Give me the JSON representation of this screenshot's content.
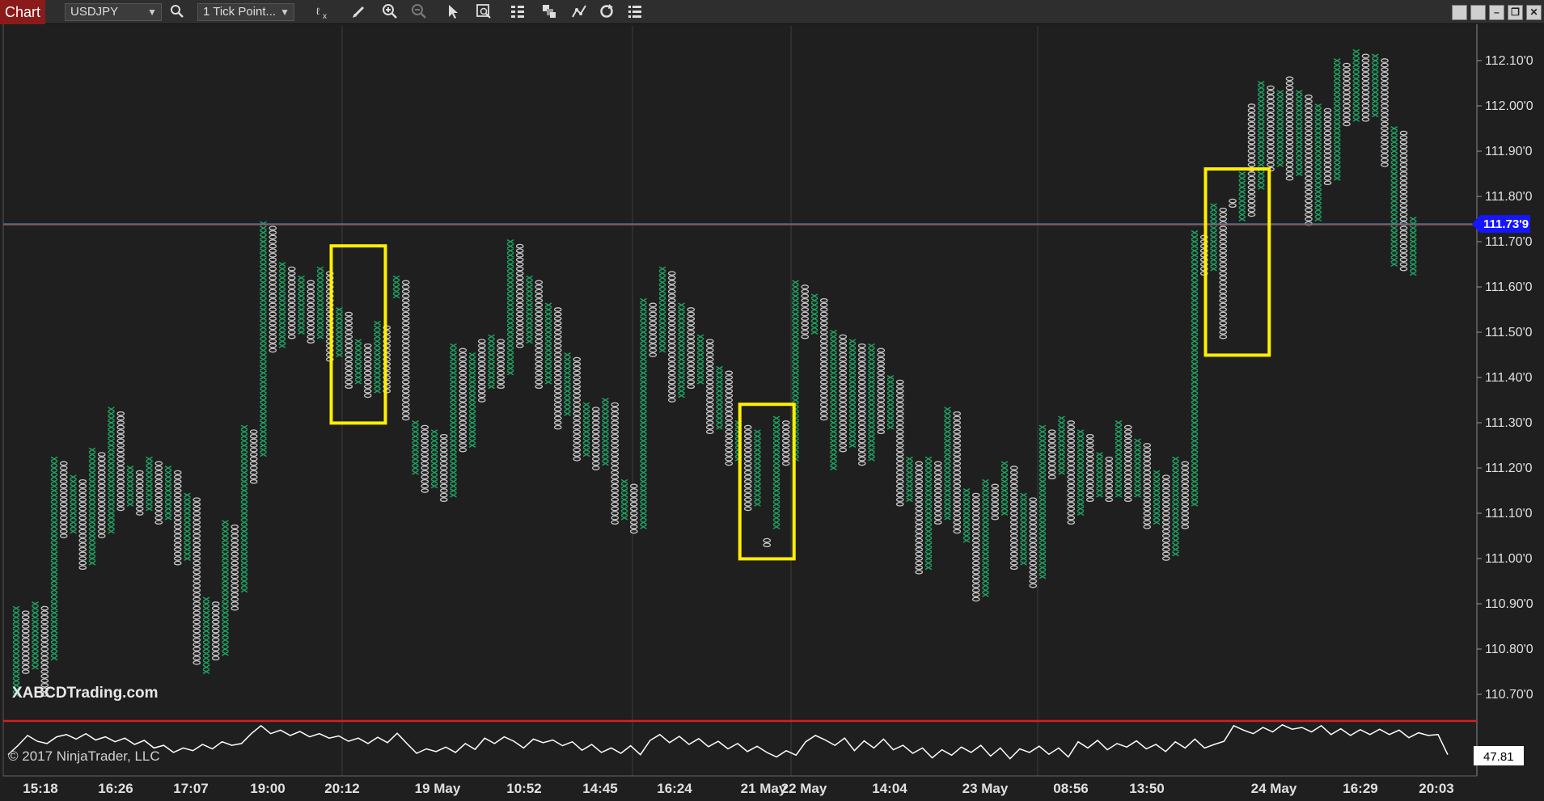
{
  "window": {
    "tab_label": "Chart"
  },
  "toolbar": {
    "instrument": "USDJPY",
    "bar_type": "1 Tick Point...",
    "icons": [
      "search-icon",
      "indicator-icon",
      "draw-pencil-icon",
      "zoom-in-icon",
      "zoom-out-icon",
      "pointer-icon",
      "data-box-icon",
      "grid-icon",
      "strategies-icon",
      "drawing-tools-icon",
      "reload-icon",
      "properties-icon"
    ],
    "window_buttons": [
      "tile-left",
      "tile-right",
      "minimize",
      "maximize",
      "close"
    ]
  },
  "watermark": "XABCDTrading.com",
  "copyright": "© 2017 NinjaTrader, LLC",
  "price_axis": {
    "labels": [
      "112.10'0",
      "112.00'0",
      "111.90'0",
      "111.80'0",
      "111.70'0",
      "111.60'0",
      "111.50'0",
      "111.40'0",
      "111.30'0",
      "111.20'0",
      "111.10'0",
      "111.00'0",
      "110.90'0",
      "110.80'0",
      "110.70'0"
    ],
    "current_price": "111.73'9",
    "current_price_color": "#1515ff"
  },
  "indicator": {
    "current_value": "47.81"
  },
  "time_axis": {
    "labels": [
      "15:18",
      "16:26",
      "17:07",
      "19:00",
      "20:12",
      "19 May",
      "10:52",
      "14:45",
      "16:24",
      "21 May",
      "22 May",
      "14:04",
      "23 May",
      "08:56",
      "13:50",
      "24 May",
      "16:29",
      "20:03"
    ]
  },
  "colors": {
    "up": "#1fa463",
    "down": "#c8c8c8",
    "highlight": "#ffef00",
    "background": "#1f1f1f"
  },
  "chart_data": {
    "type": "point_and_figure",
    "instrument": "USDJPY",
    "box_size": 0.01,
    "current_price": 111.739,
    "ylim": [
      110.65,
      112.15
    ],
    "columns": [
      {
        "dir": "up",
        "low": 110.7,
        "high": 110.89
      },
      {
        "dir": "down",
        "low": 110.75,
        "high": 110.88
      },
      {
        "dir": "up",
        "low": 110.76,
        "high": 110.9
      },
      {
        "dir": "down",
        "low": 110.7,
        "high": 110.89
      },
      {
        "dir": "up",
        "low": 110.78,
        "high": 111.22
      },
      {
        "dir": "down",
        "low": 111.05,
        "high": 111.21
      },
      {
        "dir": "up",
        "low": 111.06,
        "high": 111.18
      },
      {
        "dir": "down",
        "low": 110.98,
        "high": 111.17
      },
      {
        "dir": "up",
        "low": 110.99,
        "high": 111.24
      },
      {
        "dir": "down",
        "low": 111.05,
        "high": 111.23
      },
      {
        "dir": "up",
        "low": 111.06,
        "high": 111.33
      },
      {
        "dir": "down",
        "low": 111.11,
        "high": 111.32
      },
      {
        "dir": "up",
        "low": 111.12,
        "high": 111.2
      },
      {
        "dir": "down",
        "low": 111.1,
        "high": 111.19
      },
      {
        "dir": "up",
        "low": 111.11,
        "high": 111.22
      },
      {
        "dir": "down",
        "low": 111.08,
        "high": 111.21
      },
      {
        "dir": "up",
        "low": 111.09,
        "high": 111.2
      },
      {
        "dir": "down",
        "low": 110.99,
        "high": 111.19
      },
      {
        "dir": "up",
        "low": 111.0,
        "high": 111.14
      },
      {
        "dir": "down",
        "low": 110.77,
        "high": 111.13
      },
      {
        "dir": "up",
        "low": 110.75,
        "high": 110.91
      },
      {
        "dir": "down",
        "low": 110.78,
        "high": 110.9
      },
      {
        "dir": "up",
        "low": 110.79,
        "high": 111.08
      },
      {
        "dir": "down",
        "low": 110.89,
        "high": 111.07
      },
      {
        "dir": "up",
        "low": 110.93,
        "high": 111.29
      },
      {
        "dir": "down",
        "low": 111.17,
        "high": 111.28
      },
      {
        "dir": "up",
        "low": 111.23,
        "high": 111.74
      },
      {
        "dir": "down",
        "low": 111.46,
        "high": 111.73
      },
      {
        "dir": "up",
        "low": 111.47,
        "high": 111.65
      },
      {
        "dir": "down",
        "low": 111.49,
        "high": 111.64
      },
      {
        "dir": "up",
        "low": 111.5,
        "high": 111.62
      },
      {
        "dir": "down",
        "low": 111.48,
        "high": 111.61
      },
      {
        "dir": "up",
        "low": 111.49,
        "high": 111.64
      },
      {
        "dir": "down",
        "low": 111.44,
        "high": 111.63
      },
      {
        "dir": "up",
        "low": 111.45,
        "high": 111.55
      },
      {
        "dir": "down",
        "low": 111.38,
        "high": 111.54
      },
      {
        "dir": "up",
        "low": 111.39,
        "high": 111.48
      },
      {
        "dir": "down",
        "low": 111.36,
        "high": 111.47
      },
      {
        "dir": "up",
        "low": 111.37,
        "high": 111.52
      },
      {
        "dir": "down",
        "low": 111.37,
        "high": 111.51
      },
      {
        "dir": "up",
        "low": 111.58,
        "high": 111.62
      },
      {
        "dir": "down",
        "low": 111.31,
        "high": 111.61
      },
      {
        "dir": "up",
        "low": 111.19,
        "high": 111.3
      },
      {
        "dir": "down",
        "low": 111.15,
        "high": 111.29
      },
      {
        "dir": "up",
        "low": 111.16,
        "high": 111.28
      },
      {
        "dir": "down",
        "low": 111.13,
        "high": 111.27
      },
      {
        "dir": "up",
        "low": 111.14,
        "high": 111.47
      },
      {
        "dir": "down",
        "low": 111.24,
        "high": 111.46
      },
      {
        "dir": "up",
        "low": 111.25,
        "high": 111.45
      },
      {
        "dir": "down",
        "low": 111.35,
        "high": 111.48
      },
      {
        "dir": "up",
        "low": 111.38,
        "high": 111.49
      },
      {
        "dir": "down",
        "low": 111.38,
        "high": 111.48
      },
      {
        "dir": "up",
        "low": 111.41,
        "high": 111.7
      },
      {
        "dir": "down",
        "low": 111.47,
        "high": 111.69
      },
      {
        "dir": "up",
        "low": 111.48,
        "high": 111.62
      },
      {
        "dir": "down",
        "low": 111.38,
        "high": 111.61
      },
      {
        "dir": "up",
        "low": 111.39,
        "high": 111.56
      },
      {
        "dir": "down",
        "low": 111.29,
        "high": 111.55
      },
      {
        "dir": "up",
        "low": 111.32,
        "high": 111.45
      },
      {
        "dir": "down",
        "low": 111.22,
        "high": 111.44
      },
      {
        "dir": "up",
        "low": 111.23,
        "high": 111.34
      },
      {
        "dir": "down",
        "low": 111.2,
        "high": 111.33
      },
      {
        "dir": "up",
        "low": 111.21,
        "high": 111.35
      },
      {
        "dir": "down",
        "low": 111.08,
        "high": 111.34
      },
      {
        "dir": "up",
        "low": 111.09,
        "high": 111.17
      },
      {
        "dir": "down",
        "low": 111.06,
        "high": 111.16
      },
      {
        "dir": "up",
        "low": 111.07,
        "high": 111.57
      },
      {
        "dir": "down",
        "low": 111.45,
        "high": 111.56
      },
      {
        "dir": "up",
        "low": 111.46,
        "high": 111.64
      },
      {
        "dir": "down",
        "low": 111.35,
        "high": 111.63
      },
      {
        "dir": "up",
        "low": 111.36,
        "high": 111.56
      },
      {
        "dir": "down",
        "low": 111.38,
        "high": 111.55
      },
      {
        "dir": "up",
        "low": 111.39,
        "high": 111.49
      },
      {
        "dir": "down",
        "low": 111.28,
        "high": 111.48
      },
      {
        "dir": "up",
        "low": 111.29,
        "high": 111.42
      },
      {
        "dir": "down",
        "low": 111.21,
        "high": 111.41
      },
      {
        "dir": "up",
        "low": 111.22,
        "high": 111.3
      },
      {
        "dir": "down",
        "low": 111.11,
        "high": 111.29
      },
      {
        "dir": "up",
        "low": 111.12,
        "high": 111.28
      },
      {
        "dir": "down",
        "low": 111.05,
        "high": 111.04
      },
      {
        "dir": "up",
        "low": 111.07,
        "high": 111.31
      },
      {
        "dir": "down",
        "low": 111.21,
        "high": 111.3
      },
      {
        "dir": "up",
        "low": 111.22,
        "high": 111.61
      },
      {
        "dir": "down",
        "low": 111.49,
        "high": 111.6
      },
      {
        "dir": "up",
        "low": 111.5,
        "high": 111.58
      },
      {
        "dir": "down",
        "low": 111.31,
        "high": 111.57
      },
      {
        "dir": "up",
        "low": 111.2,
        "high": 111.5
      },
      {
        "dir": "down",
        "low": 111.24,
        "high": 111.49
      },
      {
        "dir": "up",
        "low": 111.25,
        "high": 111.48
      },
      {
        "dir": "down",
        "low": 111.21,
        "high": 111.47
      },
      {
        "dir": "up",
        "low": 111.22,
        "high": 111.47
      },
      {
        "dir": "down",
        "low": 111.28,
        "high": 111.46
      },
      {
        "dir": "up",
        "low": 111.29,
        "high": 111.4
      },
      {
        "dir": "down",
        "low": 111.12,
        "high": 111.39
      },
      {
        "dir": "up",
        "low": 111.13,
        "high": 111.22
      },
      {
        "dir": "down",
        "low": 110.97,
        "high": 111.21
      },
      {
        "dir": "up",
        "low": 110.98,
        "high": 111.22
      },
      {
        "dir": "down",
        "low": 111.08,
        "high": 111.21
      },
      {
        "dir": "up",
        "low": 111.09,
        "high": 111.33
      },
      {
        "dir": "down",
        "low": 111.06,
        "high": 111.32
      },
      {
        "dir": "up",
        "low": 111.04,
        "high": 111.15
      },
      {
        "dir": "down",
        "low": 110.91,
        "high": 111.14
      },
      {
        "dir": "up",
        "low": 110.92,
        "high": 111.17
      },
      {
        "dir": "down",
        "low": 111.09,
        "high": 111.16
      },
      {
        "dir": "up",
        "low": 111.1,
        "high": 111.21
      },
      {
        "dir": "down",
        "low": 110.98,
        "high": 111.2
      },
      {
        "dir": "up",
        "low": 110.99,
        "high": 111.14
      },
      {
        "dir": "down",
        "low": 110.94,
        "high": 111.13
      },
      {
        "dir": "up",
        "low": 110.96,
        "high": 111.29
      },
      {
        "dir": "down",
        "low": 111.18,
        "high": 111.28
      },
      {
        "dir": "up",
        "low": 111.19,
        "high": 111.31
      },
      {
        "dir": "down",
        "low": 111.08,
        "high": 111.3
      },
      {
        "dir": "up",
        "low": 111.1,
        "high": 111.28
      },
      {
        "dir": "down",
        "low": 111.13,
        "high": 111.27
      },
      {
        "dir": "up",
        "low": 111.14,
        "high": 111.23
      },
      {
        "dir": "down",
        "low": 111.13,
        "high": 111.22
      },
      {
        "dir": "up",
        "low": 111.14,
        "high": 111.3
      },
      {
        "dir": "down",
        "low": 111.13,
        "high": 111.29
      },
      {
        "dir": "up",
        "low": 111.14,
        "high": 111.26
      },
      {
        "dir": "down",
        "low": 111.07,
        "high": 111.25
      },
      {
        "dir": "up",
        "low": 111.08,
        "high": 111.19
      },
      {
        "dir": "down",
        "low": 111.0,
        "high": 111.18
      },
      {
        "dir": "up",
        "low": 111.01,
        "high": 111.22
      },
      {
        "dir": "down",
        "low": 111.07,
        "high": 111.21
      },
      {
        "dir": "up",
        "low": 111.12,
        "high": 111.72
      },
      {
        "dir": "down",
        "low": 111.63,
        "high": 111.71
      },
      {
        "dir": "up",
        "low": 111.64,
        "high": 111.78
      },
      {
        "dir": "down",
        "low": 111.49,
        "high": 111.77
      },
      {
        "dir": "down",
        "low": 111.79,
        "high": 111.79
      },
      {
        "dir": "up",
        "low": 111.75,
        "high": 111.85
      },
      {
        "dir": "down",
        "low": 111.76,
        "high": 112.0
      },
      {
        "dir": "up",
        "low": 111.82,
        "high": 112.05
      },
      {
        "dir": "down",
        "low": 111.86,
        "high": 112.04
      },
      {
        "dir": "up",
        "low": 111.87,
        "high": 112.03
      },
      {
        "dir": "down",
        "low": 111.84,
        "high": 112.06
      },
      {
        "dir": "up",
        "low": 111.85,
        "high": 112.03
      },
      {
        "dir": "down",
        "low": 111.74,
        "high": 112.02
      },
      {
        "dir": "up",
        "low": 111.75,
        "high": 112.0
      },
      {
        "dir": "down",
        "low": 111.83,
        "high": 111.99
      },
      {
        "dir": "up",
        "low": 111.84,
        "high": 112.1
      },
      {
        "dir": "down",
        "low": 111.96,
        "high": 112.09
      },
      {
        "dir": "up",
        "low": 111.97,
        "high": 112.12
      },
      {
        "dir": "down",
        "low": 111.97,
        "high": 112.11
      },
      {
        "dir": "up",
        "low": 111.98,
        "high": 112.11
      },
      {
        "dir": "down",
        "low": 111.87,
        "high": 112.1
      },
      {
        "dir": "up",
        "low": 111.65,
        "high": 111.95
      },
      {
        "dir": "down",
        "low": 111.64,
        "high": 111.94
      },
      {
        "dir": "up",
        "low": 111.63,
        "high": 111.75
      }
    ],
    "highlight_boxes": [
      {
        "from_col": 34,
        "to_col": 38,
        "low": 111.31,
        "high": 111.68
      },
      {
        "from_col": 77,
        "to_col": 81,
        "low": 111.01,
        "high": 111.33
      },
      {
        "from_col": 126,
        "to_col": 131,
        "low": 111.46,
        "high": 111.85
      }
    ],
    "indicator_series": [
      15,
      35,
      58,
      45,
      40,
      55,
      60,
      50,
      62,
      48,
      55,
      44,
      52,
      38,
      47,
      30,
      36,
      20,
      30,
      24,
      38,
      28,
      44,
      36,
      40,
      62,
      80,
      62,
      70,
      58,
      67,
      55,
      62,
      52,
      57,
      45,
      52,
      40,
      54,
      42,
      63,
      40,
      18,
      28,
      22,
      32,
      20,
      40,
      27,
      52,
      40,
      55,
      45,
      30,
      50,
      42,
      48,
      35,
      44,
      25,
      38,
      20,
      30,
      18,
      35,
      15,
      47,
      60,
      42,
      56,
      38,
      51,
      33,
      45,
      28,
      40,
      22,
      34,
      20,
      10,
      24,
      14,
      44,
      58,
      48,
      36,
      52,
      24,
      46,
      30,
      50,
      26,
      36,
      18,
      30,
      8,
      26,
      14,
      32,
      20,
      36,
      12,
      30,
      6,
      28,
      20,
      34,
      16,
      30,
      10,
      44,
      30,
      47,
      26,
      40,
      32,
      46,
      28,
      38,
      22,
      44,
      30,
      50,
      30,
      38,
      45,
      80,
      70,
      62,
      76,
      66,
      82,
      72,
      76,
      66,
      80,
      60,
      73,
      58,
      71,
      60,
      72,
      60,
      70,
      53,
      64,
      58,
      60,
      15
    ],
    "time_labels": [
      "15:18",
      "16:26",
      "17:07",
      "19:00",
      "20:12",
      "19 May",
      "10:52",
      "14:45",
      "16:24",
      "21 May",
      "22 May",
      "14:04",
      "23 May",
      "08:56",
      "13:50",
      "24 May",
      "16:29",
      "20:03"
    ]
  }
}
